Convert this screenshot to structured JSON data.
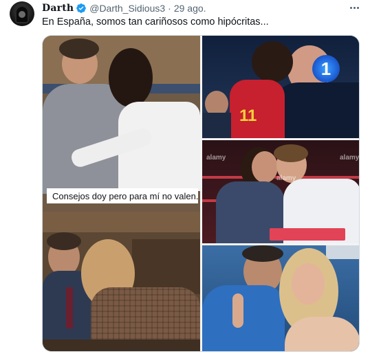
{
  "user": {
    "display_name": "Darth",
    "handle": "@Darth_Sidious3",
    "separator": "·",
    "date": "29 ago."
  },
  "tweet": {
    "text": "En España, somos tan cariñosos como hipócritas..."
  },
  "media": {
    "caption": "Consejos doy pero para mí no valen.",
    "watermarks": [
      "alamy",
      "alamy",
      "alamy"
    ],
    "badge_number": "1",
    "jersey_number": "11"
  },
  "colors": {
    "verified": "#1d9bf0",
    "text_primary": "#0f1419",
    "text_secondary": "#536471",
    "border": "#cfd9de"
  },
  "icons": {
    "verified": "verified-badge-icon",
    "more": "more-options-icon"
  }
}
